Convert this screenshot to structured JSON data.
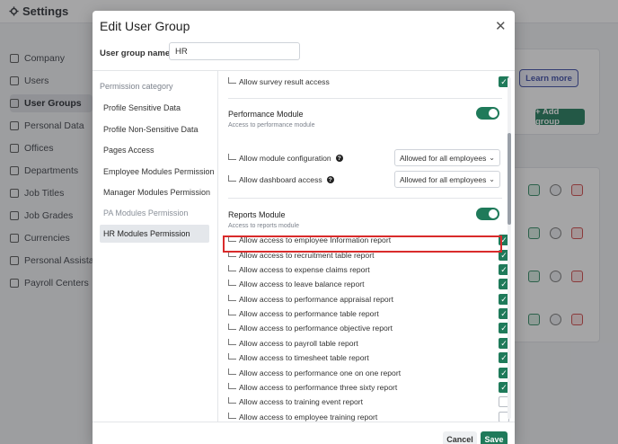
{
  "app": {
    "title": "Settings",
    "icon": "gear-icon"
  },
  "sidebar": {
    "items": [
      {
        "label": "Company",
        "icon": "building-icon"
      },
      {
        "label": "Users",
        "icon": "users-icon"
      },
      {
        "label": "User Groups",
        "icon": "user-group-icon",
        "active": true
      },
      {
        "label": "Personal Data",
        "icon": "id-card-icon"
      },
      {
        "label": "Offices",
        "icon": "office-icon"
      },
      {
        "label": "Departments",
        "icon": "departments-icon"
      },
      {
        "label": "Job Titles",
        "icon": "briefcase-icon"
      },
      {
        "label": "Job Grades",
        "icon": "grade-icon"
      },
      {
        "label": "Currencies",
        "icon": "exchange-icon"
      },
      {
        "label": "Personal Assistant",
        "icon": "assistant-icon"
      },
      {
        "label": "Payroll Centers",
        "icon": "payroll-icon"
      }
    ]
  },
  "background": {
    "learn_more": "Learn more",
    "add_group": "+ Add group"
  },
  "modal": {
    "title": "Edit User Group",
    "group_name_label": "User group name",
    "group_name_value": "HR",
    "category_heading": "Permission category",
    "categories": [
      {
        "label": "Profile Sensitive Data"
      },
      {
        "label": "Profile Non-Sensitive Data"
      },
      {
        "label": "Pages Access"
      },
      {
        "label": "Employee Modules Permission"
      },
      {
        "label": "Manager Modules Permission"
      },
      {
        "label": "PA Modules Permission",
        "muted": true
      },
      {
        "label": "HR Modules Permission",
        "active": true
      }
    ],
    "survey_row": {
      "label": "Allow survey result access",
      "checked": true
    },
    "performance": {
      "title": "Performance Module",
      "subtitle": "Access to performance module",
      "enabled": true,
      "rows": [
        {
          "label": "Allow module configuration",
          "select": "Allowed for all employees"
        },
        {
          "label": "Allow dashboard access",
          "select": "Allowed for all employees"
        }
      ]
    },
    "reports": {
      "title": "Reports Module",
      "subtitle": "Access to reports module",
      "enabled": true,
      "rows": [
        {
          "label": "Allow access to employee Information report",
          "checked": true
        },
        {
          "label": "Allow access to recruitment table report",
          "checked": true,
          "highlighted": true
        },
        {
          "label": "Allow access to expense claims report",
          "checked": true
        },
        {
          "label": "Allow access to leave balance report",
          "checked": true
        },
        {
          "label": "Allow access to performance appraisal report",
          "checked": true
        },
        {
          "label": "Allow access to performance table report",
          "checked": true
        },
        {
          "label": "Allow access to performance objective report",
          "checked": true
        },
        {
          "label": "Allow access to payroll table report",
          "checked": true
        },
        {
          "label": "Allow access to timesheet table report",
          "checked": true
        },
        {
          "label": "Allow access to performance one on one report",
          "checked": true
        },
        {
          "label": "Allow access to performance three sixty report",
          "checked": true
        },
        {
          "label": "Allow access to training event report",
          "checked": false
        },
        {
          "label": "Allow access to employee training report",
          "checked": false
        }
      ]
    },
    "cancel_label": "Cancel",
    "save_label": "Save"
  },
  "colors": {
    "accent": "#1f7a5a",
    "highlight": "#d92b2b",
    "link": "#3b4aa5"
  }
}
